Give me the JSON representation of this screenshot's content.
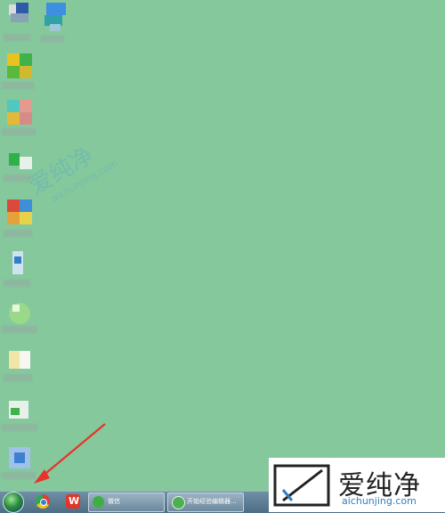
{
  "watermark": {
    "cn": "爱纯净",
    "en": "aichunjing.com"
  },
  "logo": {
    "cn": "爱纯净",
    "en": "aichunjing.com"
  },
  "taskbar": {
    "start_icon": "windows-orb-icon",
    "quick_launch": [
      "chrome-icon",
      "wps-icon"
    ],
    "buttons": [
      {
        "label": "微信",
        "icon": "wechat-icon",
        "color": "#3cb043"
      },
      {
        "label": "开始经验编辑器...",
        "icon": "editor-icon",
        "color": "#4caf50"
      }
    ]
  },
  "colors": {
    "desktop": "#84c89c",
    "taskbar": "#5a7a92",
    "arrow": "#e8322a"
  }
}
